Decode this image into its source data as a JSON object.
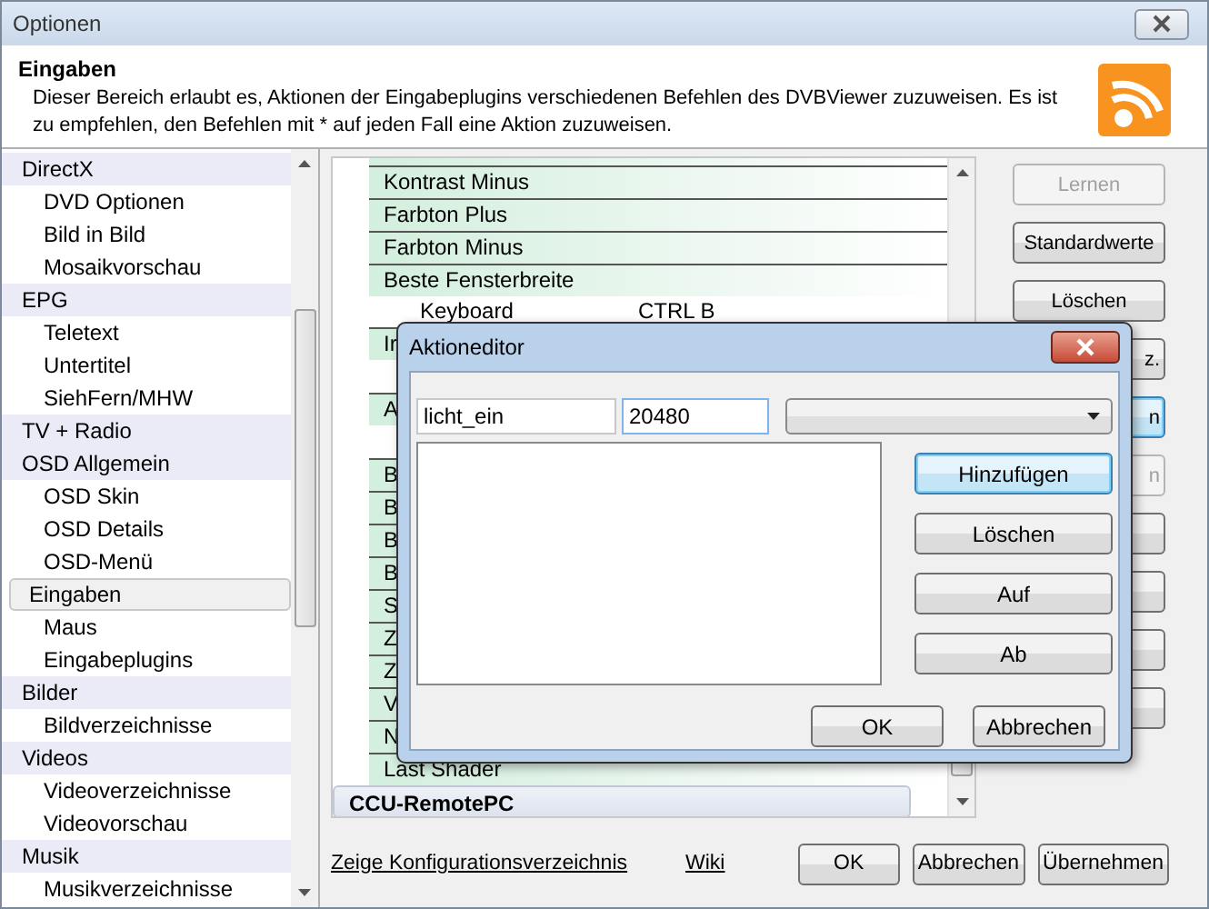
{
  "window": {
    "title": "Optionen"
  },
  "header": {
    "title": "Eingaben",
    "description": "Dieser Bereich erlaubt es, Aktionen der Eingabeplugins verschiedenen Befehlen des DVBViewer zuzuweisen. Es ist zu empfehlen, den Befehlen mit * auf jeden Fall eine Aktion zuzuweisen."
  },
  "sidebar": {
    "items": [
      {
        "label": "DirectX",
        "kind": "group",
        "selected": false
      },
      {
        "label": "DVD Optionen",
        "kind": "child",
        "selected": false
      },
      {
        "label": "Bild in Bild",
        "kind": "child",
        "selected": false
      },
      {
        "label": "Mosaikvorschau",
        "kind": "child",
        "selected": false
      },
      {
        "label": "EPG",
        "kind": "group",
        "selected": false
      },
      {
        "label": "Teletext",
        "kind": "child",
        "selected": false
      },
      {
        "label": "Untertitel",
        "kind": "child",
        "selected": false
      },
      {
        "label": "SiehFern/MHW",
        "kind": "child",
        "selected": false
      },
      {
        "label": "TV + Radio",
        "kind": "group",
        "selected": false
      },
      {
        "label": "OSD Allgemein",
        "kind": "group",
        "selected": false
      },
      {
        "label": "OSD Skin",
        "kind": "child",
        "selected": false
      },
      {
        "label": "OSD Details",
        "kind": "child",
        "selected": false
      },
      {
        "label": "OSD-Menü",
        "kind": "child",
        "selected": false
      },
      {
        "label": "Eingaben",
        "kind": "group",
        "selected": true
      },
      {
        "label": "Maus",
        "kind": "child",
        "selected": false
      },
      {
        "label": "Eingabeplugins",
        "kind": "child",
        "selected": false
      },
      {
        "label": "Bilder",
        "kind": "group",
        "selected": false
      },
      {
        "label": "Bildverzeichnisse",
        "kind": "child",
        "selected": false
      },
      {
        "label": "Videos",
        "kind": "group",
        "selected": false
      },
      {
        "label": "Videoverzeichnisse",
        "kind": "child",
        "selected": false
      },
      {
        "label": "Videovorschau",
        "kind": "child",
        "selected": false
      },
      {
        "label": "Musik",
        "kind": "group",
        "selected": false
      },
      {
        "label": "Musikverzeichnisse",
        "kind": "child",
        "selected": false
      }
    ]
  },
  "commands": {
    "rows": [
      {
        "kind": "command",
        "label": "Kontrast Minus"
      },
      {
        "kind": "command",
        "label": "Farbton Plus"
      },
      {
        "kind": "command",
        "label": "Farbton Minus"
      },
      {
        "kind": "command",
        "label": "Beste Fensterbreite"
      },
      {
        "kind": "binding",
        "device": "Keyboard",
        "key": "CTRL B"
      },
      {
        "kind": "command",
        "label": "Ir"
      },
      {
        "kind": "gap"
      },
      {
        "kind": "command",
        "label": "A"
      },
      {
        "kind": "gap"
      },
      {
        "kind": "command",
        "label": "B"
      },
      {
        "kind": "command",
        "label": "B"
      },
      {
        "kind": "command",
        "label": "B"
      },
      {
        "kind": "command",
        "label": "B"
      },
      {
        "kind": "command",
        "label": "S"
      },
      {
        "kind": "command",
        "label": "Z"
      },
      {
        "kind": "command",
        "label": "Z"
      },
      {
        "kind": "command",
        "label": "V"
      },
      {
        "kind": "command",
        "label": "N"
      },
      {
        "kind": "command",
        "label": "Last Shader"
      },
      {
        "kind": "section",
        "label": "CCU-RemotePC"
      }
    ]
  },
  "side_buttons": [
    {
      "label": "Lernen",
      "disabled": true,
      "focused": false
    },
    {
      "label": "Standardwerte",
      "disabled": false,
      "focused": false
    },
    {
      "label": "Löschen",
      "disabled": false,
      "focused": false
    },
    {
      "label": "z.",
      "disabled": false,
      "focused": false
    },
    {
      "label": "n",
      "disabled": false,
      "focused": true
    },
    {
      "label": "n",
      "disabled": true,
      "focused": false
    },
    {
      "disabled": false,
      "focused": false
    },
    {
      "disabled": false,
      "focused": false
    },
    {
      "disabled": false,
      "focused": false
    },
    {
      "disabled": false,
      "focused": false
    }
  ],
  "footer": {
    "links": [
      "Zeige Konfigurationsverzeichnis",
      "Wiki"
    ],
    "buttons": [
      "OK",
      "Abbrechen",
      "Übernehmen"
    ]
  },
  "dialog": {
    "title": "Aktioneditor",
    "fields": [
      {
        "value": "licht_ein",
        "focused": false
      },
      {
        "value": "20480",
        "focused": true
      }
    ],
    "buttons": [
      {
        "label": "Hinzufügen",
        "focused": true
      },
      {
        "label": "Löschen",
        "focused": false
      },
      {
        "label": "Auf",
        "focused": false
      },
      {
        "label": "Ab",
        "focused": false
      }
    ],
    "footer_buttons": [
      "OK",
      "Abbrechen"
    ]
  }
}
